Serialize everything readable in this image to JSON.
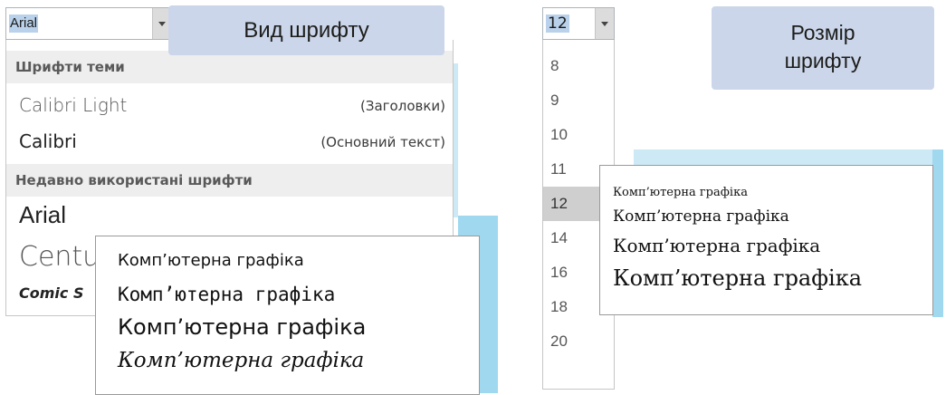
{
  "font_picker": {
    "current_value": "Arial",
    "callout": "Вид шрифту",
    "theme_header": "Шрифти теми",
    "theme_fonts": [
      {
        "name": "Calibri Light",
        "note": "(Заголовки)"
      },
      {
        "name": "Calibri",
        "note": "(Основний текст)"
      }
    ],
    "recent_header": "Недавно використані шрифти",
    "recent_fonts": [
      "Arial",
      "Centu",
      "Comic S"
    ]
  },
  "font_sample": {
    "lines": [
      "Комп’ютерна графіка",
      "Комп’ютерна графіка",
      "Комп’ютерна графіка",
      "Комп’ютерна графіка"
    ]
  },
  "size_picker": {
    "current_value": "12",
    "callout_line1": "Розмір",
    "callout_line2": "шрифту",
    "sizes": [
      "8",
      "9",
      "10",
      "11",
      "12",
      "14",
      "16",
      "18",
      "20"
    ],
    "selected": "12"
  },
  "size_sample": {
    "lines": [
      "Комп’ютерна графіка",
      "Комп’ютерна графіка",
      "Комп’ютерна графіка",
      "Комп’ютерна графіка"
    ]
  },
  "colors": {
    "callout_bg": "#cbd6ea",
    "accent_light": "#cde9f6",
    "accent": "#9fd8ef",
    "selection": "#b9d1ea"
  }
}
